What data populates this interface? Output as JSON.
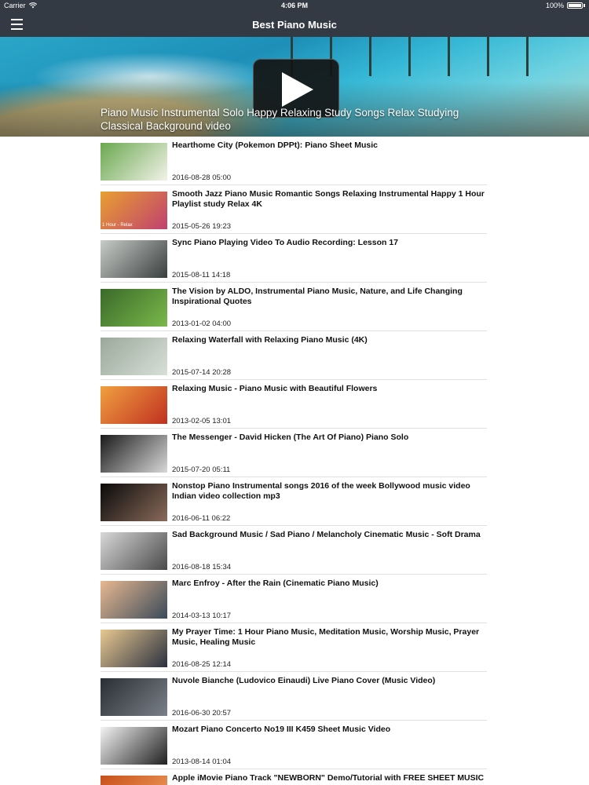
{
  "status_bar": {
    "carrier": "Carrier",
    "time": "4:06 PM",
    "battery": "100%"
  },
  "nav": {
    "title": "Best Piano Music",
    "menu_icon": "hamburger-menu-icon"
  },
  "hero": {
    "title": "Piano Music Instrumental Solo Happy Relaxing Study Songs Relax Studying Classical Background video",
    "play_icon": "play-icon"
  },
  "videos": [
    {
      "title": "Hearthome City (Pokemon DPPt): Piano Sheet Music",
      "date": "2016-08-28 05:00",
      "thumb_text": "",
      "colors": [
        "#6aa84f",
        "#f2f2e8"
      ]
    },
    {
      "title": "Smooth Jazz Piano Music Romantic Songs Relaxing Instrumental Happy 1 Hour Playlist study Relax 4K",
      "date": "2015-05-26 19:23",
      "thumb_text": "1 Hour - Relax",
      "colors": [
        "#e8a030",
        "#c04070"
      ]
    },
    {
      "title": "Sync Piano Playing Video To Audio Recording: Lesson 17",
      "date": "2015-08-11 14:18",
      "thumb_text": "",
      "colors": [
        "#c8ccc8",
        "#3a3f3f"
      ]
    },
    {
      "title": "The Vision by ALDO, Instrumental Piano Music, Nature, and Life Changing Inspirational Quotes",
      "date": "2013-01-02 04:00",
      "thumb_text": "",
      "colors": [
        "#3a6a2a",
        "#7ab84a"
      ]
    },
    {
      "title": "Relaxing Waterfall with Relaxing Piano Music (4K)",
      "date": "2015-07-14 20:28",
      "thumb_text": "",
      "colors": [
        "#9aa89a",
        "#d8e0d8"
      ]
    },
    {
      "title": "Relaxing Music - Piano Music with Beautiful Flowers",
      "date": "2013-02-05 13:01",
      "thumb_text": "",
      "colors": [
        "#f0a040",
        "#c03020"
      ]
    },
    {
      "title": "The Messenger - David Hicken (The Art Of Piano) Piano Solo",
      "date": "2015-07-20 05:11",
      "thumb_text": "",
      "colors": [
        "#1a1a1a",
        "#d8d8d8"
      ]
    },
    {
      "title": "Nonstop Piano Instrumental songs 2016 of the week Bollywood music video Indian video collection mp3",
      "date": "2016-06-11 06:22",
      "thumb_text": "",
      "colors": [
        "#0a0a0a",
        "#8a6a5a"
      ]
    },
    {
      "title": "Sad Background Music / Sad Piano / Melancholy Cinematic Music - Soft Drama",
      "date": "2016-08-18 15:34",
      "thumb_text": "",
      "colors": [
        "#d8d8d8",
        "#4a4a4a"
      ]
    },
    {
      "title": "Marc Enfroy - After the Rain (Cinematic Piano Music)",
      "date": "2014-03-13 10:17",
      "thumb_text": "",
      "colors": [
        "#e8b890",
        "#3a4a5a"
      ]
    },
    {
      "title": "My Prayer Time: 1 Hour Piano Music, Meditation Music, Worship Music, Prayer Music, Healing Music",
      "date": "2016-08-25 12:14",
      "thumb_text": "",
      "colors": [
        "#e8c890",
        "#2a3040"
      ]
    },
    {
      "title": "Nuvole Bianche (Ludovico Einaudi) Live Piano Cover (Music Video)",
      "date": "2016-06-30 20:57",
      "thumb_text": "",
      "colors": [
        "#2a2e34",
        "#7a8088"
      ]
    },
    {
      "title": "Mozart Piano Concerto No19 III K459 Sheet Music Video",
      "date": "2013-08-14 01:04",
      "thumb_text": "",
      "colors": [
        "#f4f4f4",
        "#202020"
      ]
    },
    {
      "title": "Apple iMovie Piano Track \"NEWBORN\" Demo/Tutorial with FREE SHEET MUSIC",
      "date": "",
      "thumb_text": "",
      "colors": [
        "#c8501a",
        "#f0a060"
      ]
    }
  ]
}
